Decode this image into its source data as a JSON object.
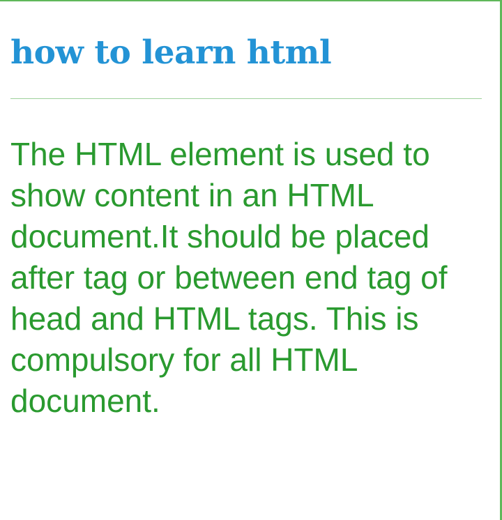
{
  "article": {
    "title": "how to learn html",
    "body": "The HTML element is used to show content in an HTML document.It should be placed after tag or between end tag of head and HTML tags. This is compulsory for all HTML document."
  },
  "colors": {
    "title": "#2393d5",
    "body_text": "#2a9a2f",
    "border": "#5fb85a",
    "divider": "#9ed09b",
    "background": "#ffffff"
  }
}
